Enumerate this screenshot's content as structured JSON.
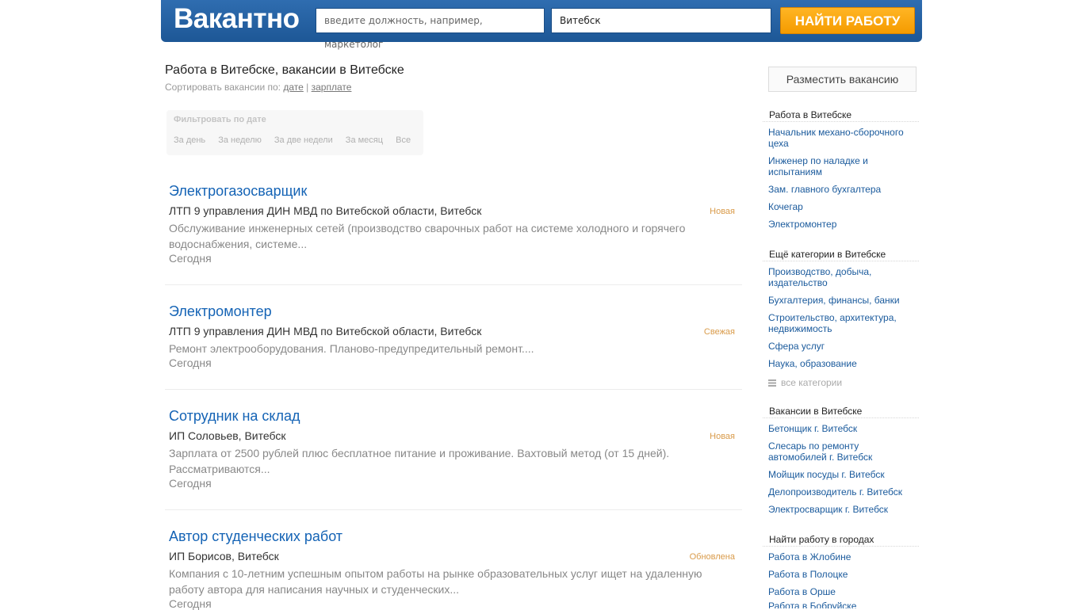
{
  "header": {
    "logo": "Вакантно",
    "search_placeholder": "введите должность, например, маркетолог",
    "city_value": "Витебск",
    "find_button": "НАЙТИ РАБОТУ"
  },
  "page": {
    "title": "Работа в Витебске, вакансии в Витебске",
    "sort_label": "Сортировать вакансии по:",
    "sort_by_date": "дате",
    "sort_sep": "|",
    "sort_by_salary": "зарплате"
  },
  "filter": {
    "title": "Фильтровать по дате",
    "options": [
      "За день",
      "За неделю",
      "За две недели",
      "За месяц",
      "Все"
    ]
  },
  "jobs": [
    {
      "title": "Электрогазосварщик",
      "company": "ЛТП 9 управления ДИН МВД по Витебской области, Витебск",
      "badge": "Новая",
      "desc": "Обслуживание инженерных сетей (производство сварочных работ на системе холодного и горячего водоснабжения, системе...",
      "date": "Сегодня"
    },
    {
      "title": "Электромонтер",
      "company": "ЛТП 9 управления ДИН МВД по Витебской области, Витебск",
      "badge": "Свежая",
      "desc": "Ремонт электрооборудования. Планово-предупредительный ремонт....",
      "date": "Сегодня"
    },
    {
      "title": "Сотрудник на склад",
      "company": "ИП Соловьев, Витебск",
      "badge": "Новая",
      "desc": "Зарплата от 2500 рублей плюс бесплатное питание и проживание. Вахтовый метод (от 15 дней). Рассматриваются...",
      "date": "Сегодня"
    },
    {
      "title": "Автор студенческих работ",
      "company": "ИП Борисов, Витебск",
      "badge": "Обновлена",
      "desc": "Компания с 10-летним успешным опытом работы на рынке образовательных услуг ищет на удаленную работу автора для написания научных и студенческих...",
      "date": "Сегодня"
    }
  ],
  "sidebar": {
    "post_button": "Разместить вакансию",
    "work_head": "Работа в Витебске",
    "work_links": [
      "Начальник механо-сборочного цеха",
      "Инженер по наладке и испытаниям",
      "Зам. главного бухгалтера",
      "Кочегар",
      "Электромонтер"
    ],
    "cat_head": "Ещё категории в Витебске",
    "cat_links": [
      "Производство, добыча, издательство",
      "Бухгалтерия, финансы, банки",
      "Строительство, архитектура, недвижимость",
      "Сфера услуг",
      "Наука, образование"
    ],
    "all_categories": "все категории",
    "vac_head": "Вакансии в Витебске",
    "vac_links": [
      "Бетонщик г. Витебск",
      "Слесарь по ремонту автомобилей г. Витебск",
      "Мойщик посуды г. Витебск",
      "Делопроизводитель г. Витебск",
      "Электросварщик г. Витебск"
    ],
    "city_head": "Найти работу в городах",
    "city_links": [
      "Работа в Жлобине",
      "Работа в Полоцке",
      "Работа в Орше",
      "Работа в Бобруйске"
    ]
  },
  "colors": {
    "header_blue": "#1d5796",
    "button_orange": "#f59b00",
    "link_blue": "#1463b5",
    "badge": "#d99b4a"
  }
}
